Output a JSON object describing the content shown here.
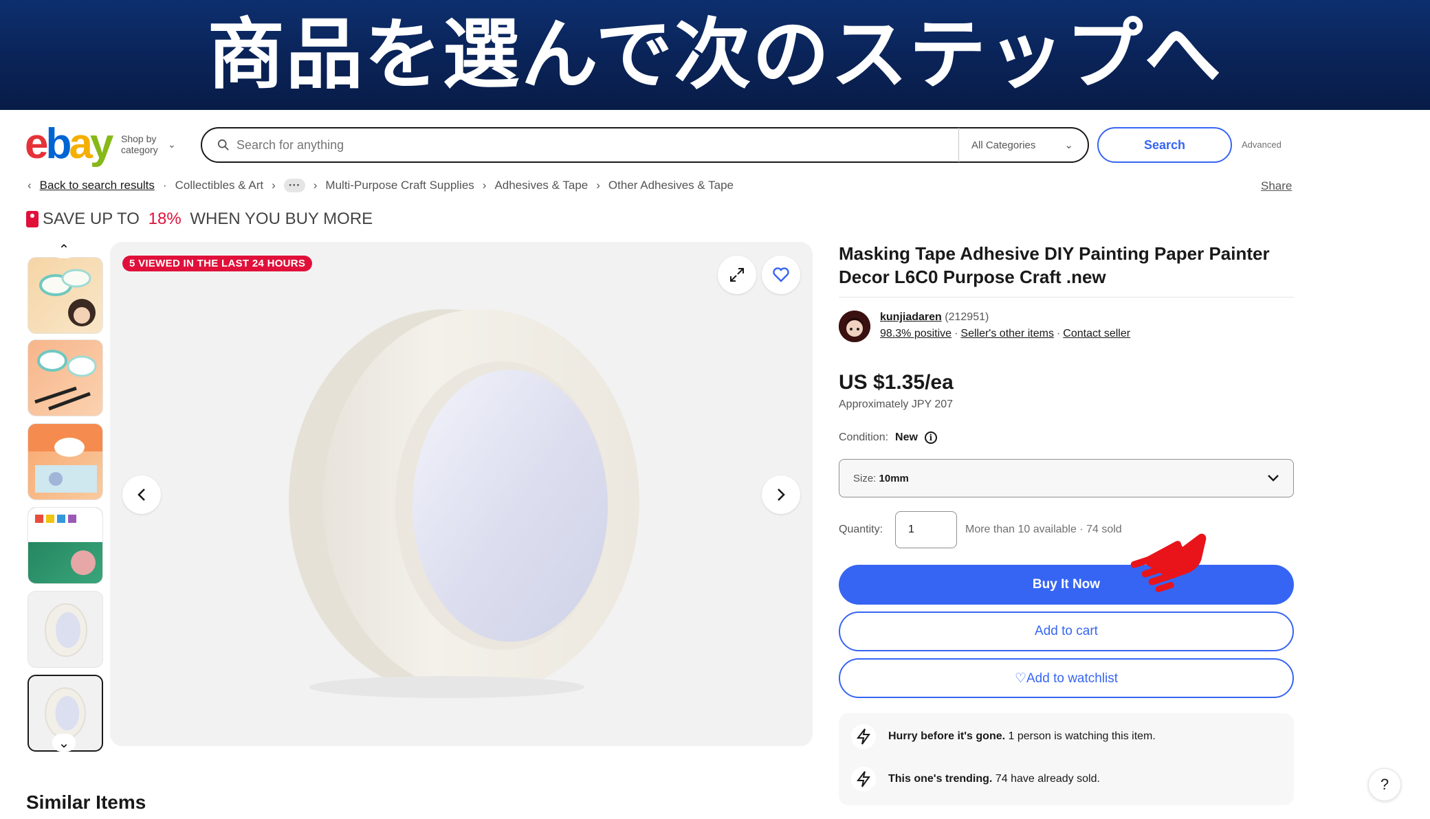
{
  "banner": {
    "title": "商品を選んで次のステップへ"
  },
  "header": {
    "logo": {
      "e": "e",
      "b": "b",
      "a": "a",
      "y": "y"
    },
    "shop_by": "Shop by category",
    "search_placeholder": "Search for anything",
    "category": "All Categories",
    "search_button": "Search",
    "advanced": "Advanced"
  },
  "breadcrumb": {
    "back": "Back to search results",
    "items": [
      "Collectibles & Art",
      "Multi-Purpose Craft Supplies",
      "Adhesives & Tape",
      "Other Adhesives & Tape"
    ],
    "share": "Share"
  },
  "promo": {
    "prefix": "SAVE UP TO ",
    "percent": "18%",
    "suffix": " WHEN YOU BUY MORE"
  },
  "gallery": {
    "viewed_badge": "5 VIEWED IN THE LAST 24 HOURS"
  },
  "product": {
    "title": "Masking Tape Adhesive DIY Painting Paper Painter Decor L6C0 Purpose Craft .new",
    "seller": {
      "name": "kunjiadaren",
      "feedback_count": "(212951)",
      "positive": "98.3% positive",
      "other_items": "Seller's other items",
      "contact": "Contact seller",
      "dot": "·"
    },
    "price": "US $1.35/ea",
    "approx": "Approximately JPY 207",
    "condition_label": "Condition:",
    "condition_value": "New",
    "size_label": "Size:",
    "size_value": "10mm",
    "quantity_label": "Quantity:",
    "quantity_value": "1",
    "availability": "More than 10 available · 74 sold",
    "buy_now": "Buy It Now",
    "add_to_cart": "Add to cart",
    "add_to_watchlist": "Add to watchlist"
  },
  "urgency": [
    {
      "bold": "Hurry before it's gone.",
      "text": " 1 person is watching this item."
    },
    {
      "bold": "This one's trending.",
      "text": " 74 have already sold."
    }
  ],
  "similar_items": "Similar Items",
  "help": "?",
  "colors": {
    "brand_blue": "#3665f3",
    "badge_red": "#e0103a",
    "banner": "#0a2357"
  }
}
